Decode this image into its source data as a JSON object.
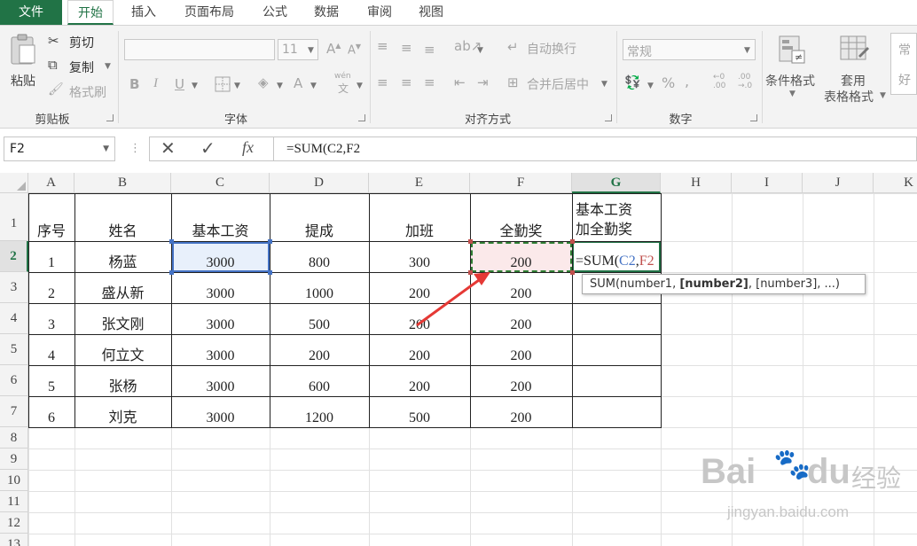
{
  "tabs": [
    "文件",
    "开始",
    "插入",
    "页面布局",
    "公式",
    "数据",
    "审阅",
    "视图"
  ],
  "active_tab": "开始",
  "clipboard": {
    "label": "剪贴板",
    "paste": "粘贴",
    "cut": "剪切",
    "copy": "复制",
    "format_painter": "格式刷"
  },
  "font": {
    "label": "字体",
    "size": "11",
    "bold": "B",
    "italic": "I",
    "underline": "U",
    "wen": "wén"
  },
  "alignment": {
    "label": "对齐方式",
    "wrap": "自动换行",
    "merge": "合并后居中"
  },
  "number": {
    "label": "数字",
    "format": "常规",
    "percent": "%"
  },
  "styles": {
    "conditional": "条件格式",
    "table_fmt_1": "套用",
    "table_fmt_2": "表格格式",
    "cell_style_1": "常",
    "cell_style_2": "好"
  },
  "namebox": "F2",
  "formula": "=SUM(C2,F2",
  "columns": [
    "A",
    "B",
    "C",
    "D",
    "E",
    "F",
    "G",
    "H",
    "I",
    "J",
    "K"
  ],
  "rows": [
    "1",
    "2",
    "3",
    "4",
    "5",
    "6",
    "7",
    "8",
    "9",
    "10",
    "11",
    "12",
    "13"
  ],
  "headers": [
    "序号",
    "姓名",
    "基本工资",
    "提成",
    "加班",
    "全勤奖"
  ],
  "g_header": [
    "基本工资",
    "加全勤奖"
  ],
  "data_rows": [
    [
      "1",
      "杨蓝",
      "3000",
      "800",
      "300",
      "200"
    ],
    [
      "2",
      "盛从新",
      "3000",
      "1000",
      "200",
      "200"
    ],
    [
      "3",
      "张文刚",
      "3000",
      "500",
      "200",
      "200"
    ],
    [
      "4",
      "何立文",
      "3000",
      "200",
      "200",
      "200"
    ],
    [
      "5",
      "张杨",
      "3000",
      "600",
      "200",
      "200"
    ],
    [
      "6",
      "刘克",
      "3000",
      "1200",
      "500",
      "200"
    ]
  ],
  "edit_cell": {
    "prefix": "=SUM(",
    "ref1": "C2",
    "comma": ",",
    "ref2": "F2"
  },
  "tooltip": {
    "fn": "SUM(number1, ",
    "bold_arg": "[number2]",
    "rest": ", [number3], ...)"
  },
  "watermark": {
    "brand": "Bai",
    "du": "du",
    "cn": "经验",
    "url": "jingyan.baidu.com"
  },
  "colors": {
    "accent": "#217346",
    "ref_blue": "#4472c4",
    "ref_red": "#c0504d",
    "arrow": "#e53935"
  }
}
